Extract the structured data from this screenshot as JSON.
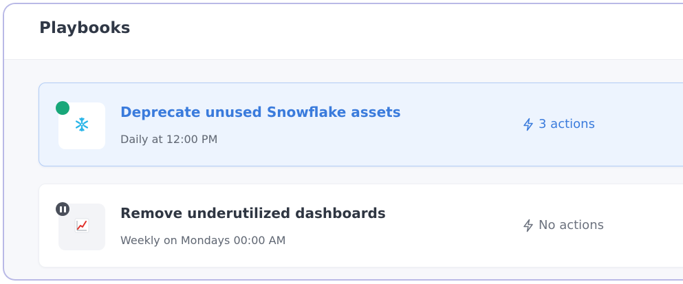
{
  "page": {
    "title": "Playbooks"
  },
  "playbooks": [
    {
      "title": "Deprecate unused Snowflake assets",
      "schedule": "Daily at 12:00 PM",
      "actions": "3 actions",
      "status": "active",
      "icon": "snowflake-icon",
      "accent_color": "#3a7bdc",
      "status_color": "#18a779"
    },
    {
      "title": "Remove underutilized dashboards",
      "schedule": "Weekly on Mondays 00:00 AM",
      "actions": "No actions",
      "status": "paused",
      "icon": "chart-trend-icon",
      "status_color": "#4a4f5a"
    }
  ]
}
